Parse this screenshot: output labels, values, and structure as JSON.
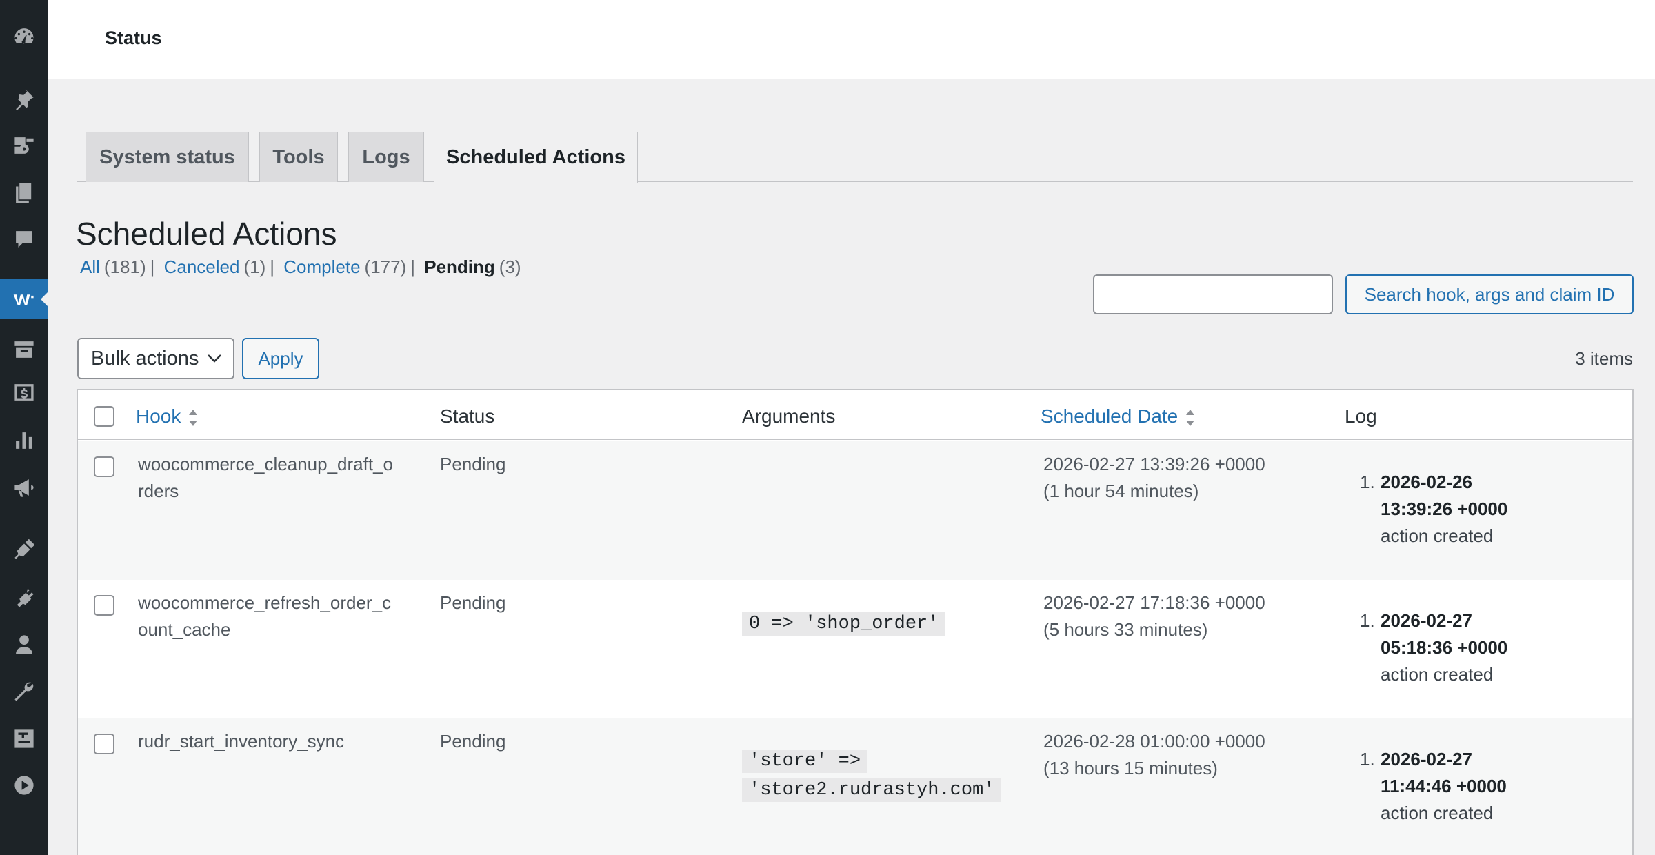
{
  "header": {
    "title": "Status"
  },
  "tabs": [
    {
      "label": "System status"
    },
    {
      "label": "Tools"
    },
    {
      "label": "Logs"
    },
    {
      "label": "Scheduled Actions"
    }
  ],
  "page_title": "Scheduled Actions",
  "filters": [
    {
      "label": "All",
      "count": "(181)"
    },
    {
      "label": "Canceled",
      "count": "(1)"
    },
    {
      "label": "Complete",
      "count": "(177)"
    },
    {
      "label": "Pending",
      "count": "(3)"
    }
  ],
  "search": {
    "placeholder": "",
    "button_label": "Search hook, args and claim ID"
  },
  "bulk": {
    "selected": "Bulk actions",
    "apply_label": "Apply"
  },
  "items_count": "3 items",
  "table": {
    "columns": {
      "hook": "Hook",
      "status": "Status",
      "arguments": "Arguments",
      "scheduled_date": "Scheduled Date",
      "log": "Log"
    },
    "rows": [
      {
        "hook_line1": "woocommerce_cleanup_draft_o",
        "hook_line2": "rders",
        "status": "Pending",
        "args_line1": "",
        "args_line2": "",
        "date": "2026-02-27 13:39:26 +0000",
        "relative": "(1 hour 54 minutes)",
        "log_num": "1.",
        "log_date": "2026-02-26",
        "log_time": "13:39:26 +0000",
        "log_msg": "action created"
      },
      {
        "hook_line1": "woocommerce_refresh_order_c",
        "hook_line2": "ount_cache",
        "status": "Pending",
        "args_line1": "0 => 'shop_order'",
        "args_line2": "",
        "date": "2026-02-27 17:18:36 +0000",
        "relative": "(5 hours 33 minutes)",
        "log_num": "1.",
        "log_date": "2026-02-27",
        "log_time": "05:18:36 +0000",
        "log_msg": "action created"
      },
      {
        "hook_line1": "rudr_start_inventory_sync",
        "hook_line2": "",
        "status": "Pending",
        "args_line1": "'store' =>",
        "args_line2": "'store2.rudrastyh.com'",
        "date": "2026-02-28 01:00:00 +0000",
        "relative": "(13 hours 15 minutes)",
        "log_num": "1.",
        "log_date": "2026-02-27",
        "log_time": "11:44:46 +0000",
        "log_msg": "action created"
      }
    ]
  },
  "sidebar": {
    "icons": [
      "dashboard-icon",
      "pin-icon",
      "media-icon",
      "pages-icon",
      "comments-icon",
      "woocommerce-icon",
      "products-icon",
      "payments-icon",
      "analytics-icon",
      "marketing-icon",
      "appearance-icon",
      "plugins-icon",
      "users-icon",
      "tools-icon",
      "settings-icon",
      "media-play-icon"
    ]
  },
  "colors": {
    "accent": "#2271b1",
    "sidebar": "#1d2327",
    "background": "#f0f0f1"
  }
}
